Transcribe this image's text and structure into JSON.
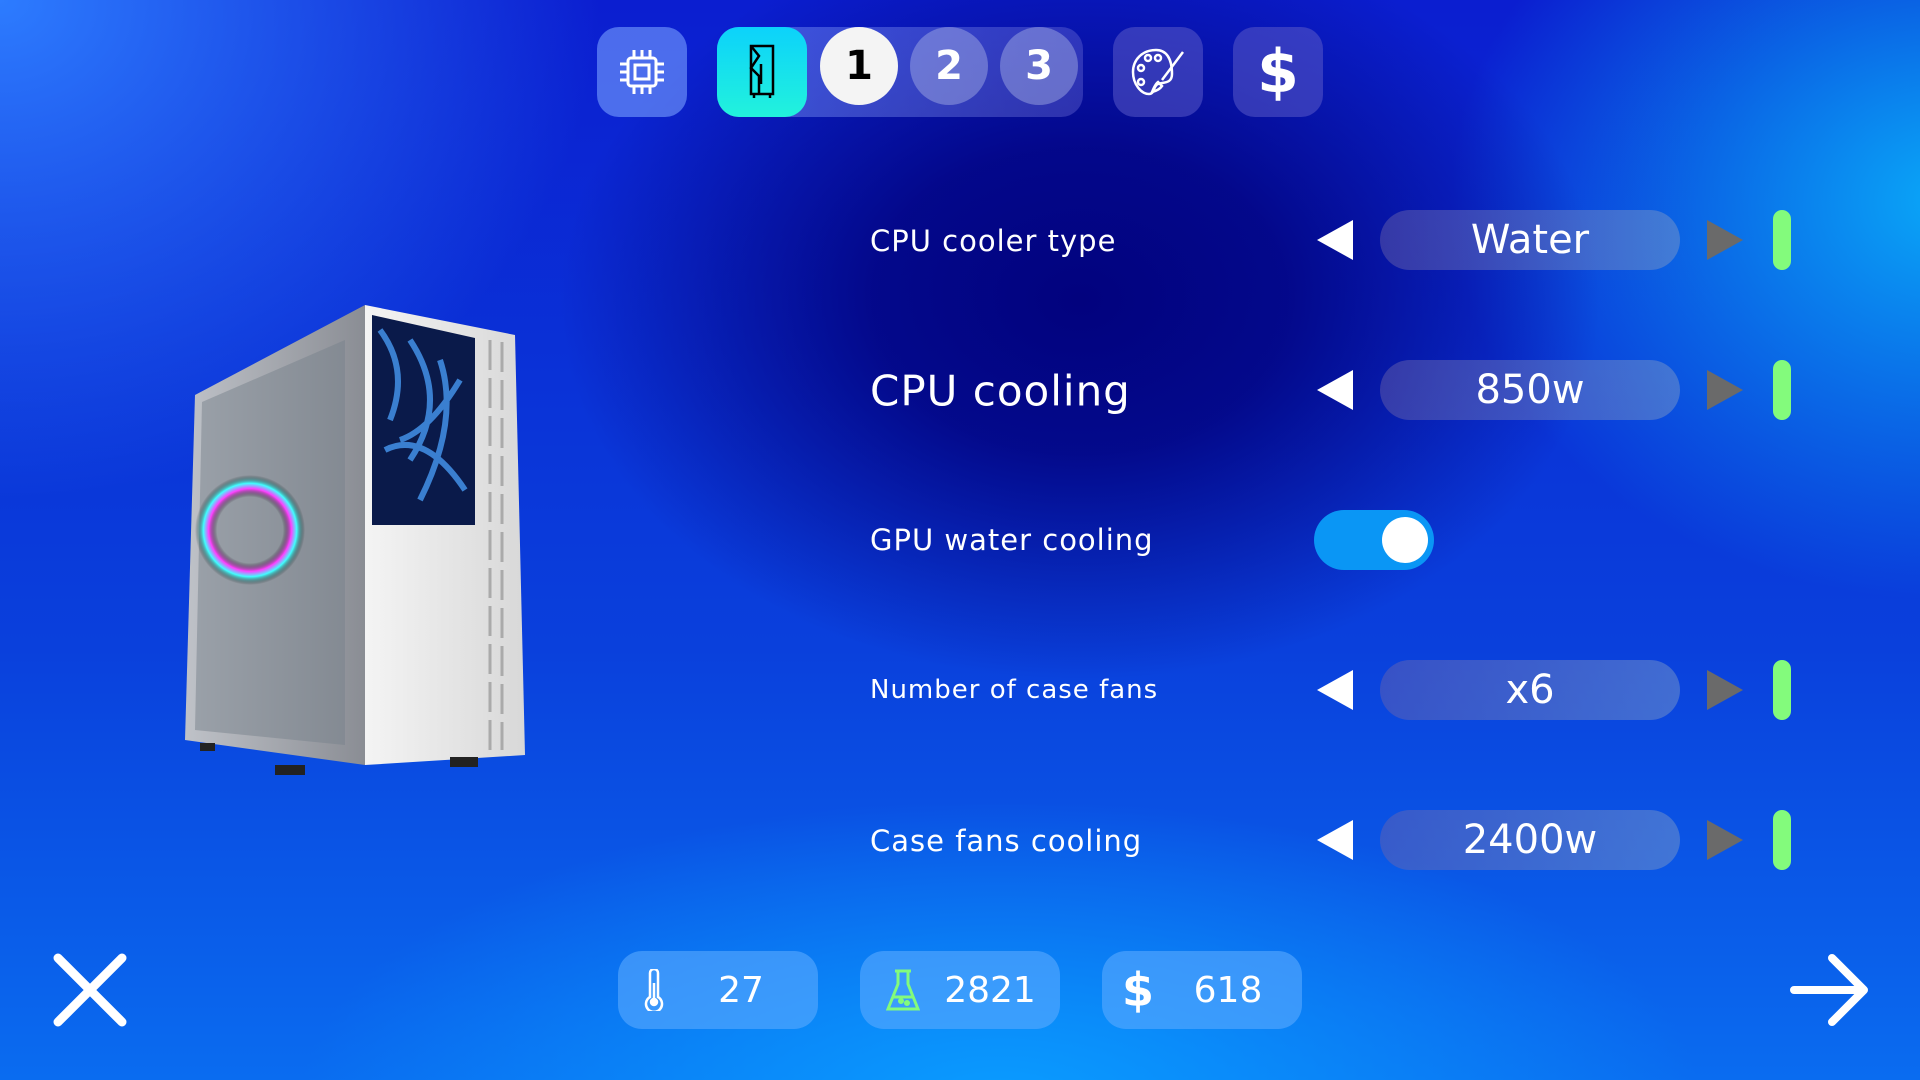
{
  "nav": {
    "items": [
      {
        "icon": "cpu-chip-icon"
      },
      {
        "icon": "pc-case-icon",
        "active": true
      },
      {
        "icon": "palette-icon"
      },
      {
        "icon": "dollar-icon",
        "label": "$"
      }
    ],
    "steps": [
      {
        "label": "1",
        "active": true
      },
      {
        "label": "2"
      },
      {
        "label": "3"
      }
    ]
  },
  "settings": [
    {
      "label": "CPU cooler type",
      "value": "Water",
      "type": "selector"
    },
    {
      "label": "CPU cooling",
      "value": "850w",
      "type": "selector"
    },
    {
      "label": "GPU water cooling",
      "type": "toggle",
      "on": true
    },
    {
      "label": "Number of case fans",
      "value": "x6",
      "type": "selector"
    },
    {
      "label": "Case fans cooling",
      "value": "2400w",
      "type": "selector"
    }
  ],
  "stats": {
    "temperature": "27",
    "research": "2821",
    "money_symbol": "$",
    "money": "618"
  },
  "colors": {
    "accent_cyan": "#12d8f0",
    "toggle_on": "#0a96f5",
    "indicator_green": "#83fb7c",
    "arrow_disabled": "#6a6a6a"
  }
}
